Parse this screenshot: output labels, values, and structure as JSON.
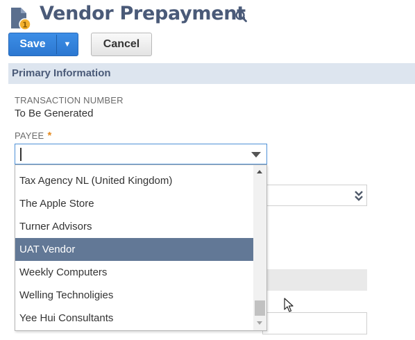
{
  "header": {
    "title": "Vendor Prepayment",
    "icon": "document-coin-icon",
    "search_icon": "search-icon"
  },
  "toolbar": {
    "save_label": "Save",
    "save_menu_icon": "triangle-down-icon",
    "cancel_label": "Cancel"
  },
  "section": {
    "title": "Primary Information"
  },
  "fields": {
    "transaction_number": {
      "label": "Transaction Number",
      "value": "To Be Generated"
    },
    "payee": {
      "label": "Payee",
      "required_marker": "*",
      "value": ""
    }
  },
  "payee_dropdown": {
    "items": [
      "Tax Agency NL (United Kingdom)",
      "The Apple Store",
      "Turner Advisors",
      "UAT Vendor",
      "Weekly Computers",
      "Welling Technoligies",
      "Yee Hui Consultants"
    ],
    "highlighted": "UAT Vendor"
  },
  "colors": {
    "accent_blue": "#2f80d8",
    "title_slate": "#4a5a78",
    "section_bg": "#dde5ef",
    "highlight_row": "#627896",
    "required_star": "#e58a1e"
  }
}
